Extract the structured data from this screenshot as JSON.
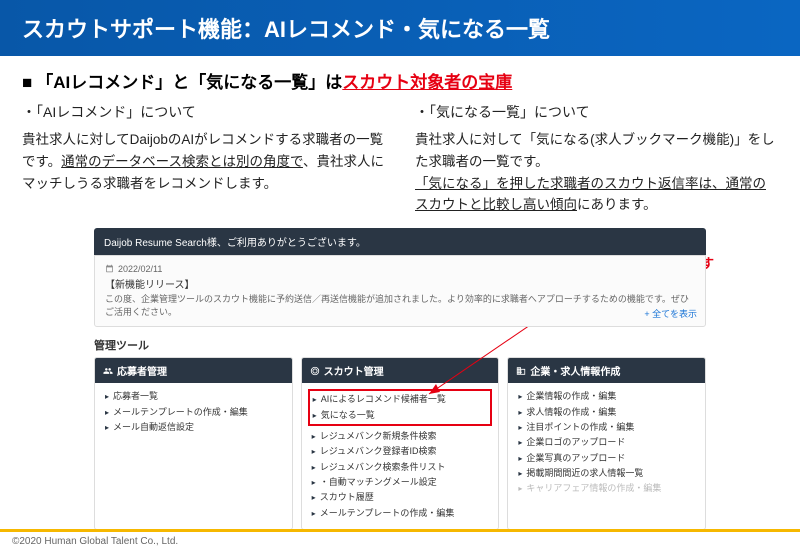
{
  "header": {
    "title": "スカウトサポート機能：AIレコメンド・気になる一覧"
  },
  "lead": {
    "part1": "「AIレコメンド」と「気になる一覧」は",
    "part2_red": "スカウト対象者の宝庫"
  },
  "left": {
    "heading": "・「AIレコメンド」について",
    "p1a": "貴社求人に対してDaijobのAIがレコメンドする求職者の一覧です。",
    "p1b": "通常のデータベース検索とは別の角度で",
    "p1c": "、貴社求人にマッチしうる求職者をレコメンドします。"
  },
  "right": {
    "heading": "・「気になる一覧」について",
    "p1": "貴社求人に対して「気になる(求人ブックマーク機能)」をした求職者の一覧です。",
    "p2a": "「気になる」を押した求職者のスカウト返信率は、通常のスカウトと比較し高い傾向",
    "p2b": "にあります。"
  },
  "callout": "こちらからご確認頂けます",
  "app": {
    "welcome": "Daijob Resume Search様、ご利用ありがとうございます。",
    "news": {
      "date": "2022/02/11",
      "title": "【新機能リリース】",
      "body": "この度、企業管理ツールのスカウト機能に予約送信／再送信機能が追加されました。より効率的に求職者へアプローチするための機能です。ぜひご活用ください。"
    },
    "show_all": "+ 全てを表示",
    "section": "管理ツール",
    "panels": {
      "applicants": {
        "title": "応募者管理",
        "items": [
          "応募者一覧",
          "メールテンプレートの作成・編集",
          "メール自動返信設定"
        ]
      },
      "scout": {
        "title": "スカウト管理",
        "highlighted": [
          "AIによるレコメンド候補者一覧",
          "気になる一覧"
        ],
        "items": [
          "レジュメバンク新規条件検索",
          "レジュメバンク登録者ID検索",
          "レジュメバンク検索条件リスト",
          "・自動マッチングメール設定",
          "スカウト履歴",
          "メールテンプレートの作成・編集"
        ]
      },
      "company": {
        "title": "企業・求人情報作成",
        "items": [
          "企業情報の作成・編集",
          "求人情報の作成・編集",
          "注目ポイントの作成・編集",
          "企業ロゴのアップロード",
          "企業写真のアップロード",
          "掲載期間間近の求人情報一覧"
        ],
        "muted": "キャリアフェア情報の作成・編集"
      }
    }
  },
  "footer": "©2020 Human Global Talent Co., Ltd."
}
